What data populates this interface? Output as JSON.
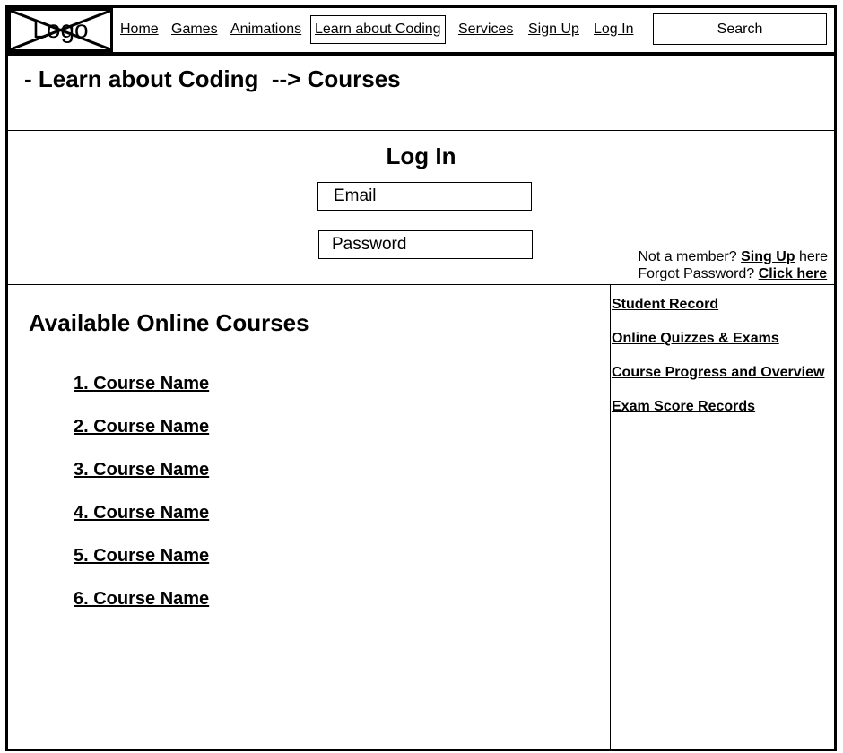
{
  "header": {
    "logo_text": "Logo",
    "nav": [
      {
        "label": "Home"
      },
      {
        "label": "Games"
      },
      {
        "label": "Animations"
      },
      {
        "label": "Learn about Coding"
      },
      {
        "label": "Services"
      },
      {
        "label": "Sign Up"
      },
      {
        "label": "Log In"
      }
    ],
    "active_nav": "Learn about Coding",
    "search_placeholder": "Search"
  },
  "breadcrumb": "- Learn about Coding  --> Courses",
  "login": {
    "title": "Log In",
    "email_placeholder": "Email",
    "password_placeholder": "Password",
    "member_prefix": "Not a member?",
    "signup_link": "Sing Up",
    "member_suffix": "here",
    "forgot_prefix": "Forgot Password?",
    "forgot_link": "Click here"
  },
  "courses": {
    "title": "Available Online Courses",
    "items": [
      "1. Course Name",
      "2. Course Name",
      "3. Course Name",
      "4. Course Name",
      "5. Course Name",
      "6. Course Name"
    ]
  },
  "sidebar": {
    "links": [
      "Student Record",
      "Online Quizzes & Exams",
      "Course Progress and Overview",
      "Exam Score Records"
    ]
  }
}
